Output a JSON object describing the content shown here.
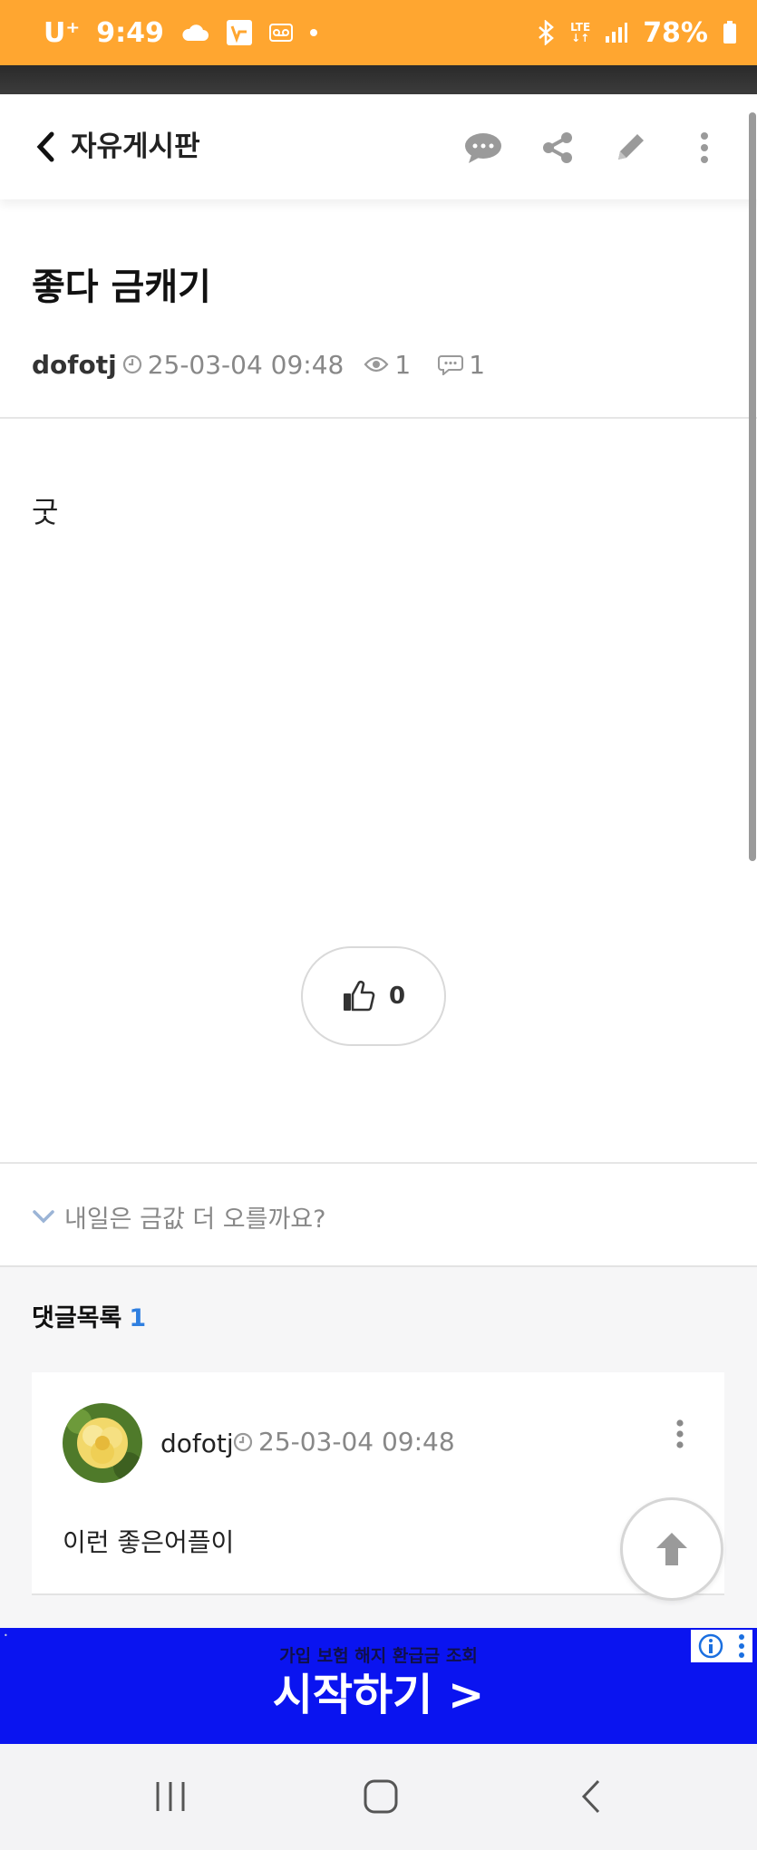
{
  "status_bar": {
    "carrier": "U⁺",
    "time": "9:49",
    "lte": "LTE",
    "battery": "78%",
    "icons": [
      "cloud-icon",
      "app-badge-icon",
      "voicemail-icon",
      "dot-icon",
      "bluetooth-icon",
      "lte-icon",
      "signal-icon",
      "battery-icon"
    ]
  },
  "header": {
    "title": "자유게시판",
    "icons": [
      "back-icon",
      "comment-bubble-icon",
      "share-icon",
      "edit-pencil-icon",
      "more-vertical-icon"
    ]
  },
  "post": {
    "title": "좋다 금캐기",
    "author": "dofotj",
    "date": "25-03-04 09:48",
    "views": "1",
    "comments": "1",
    "body": "굿",
    "likes": "0"
  },
  "next_post": {
    "title": "내일은 금값 더 오를까요?"
  },
  "comments": {
    "heading": "댓글목록",
    "count": "1",
    "items": [
      {
        "author": "dofotj",
        "date": "25-03-04 09:48",
        "text": "이런 좋은어플이"
      }
    ]
  },
  "ad": {
    "subtitle": "가입 보험 해지 환급금 조회",
    "headline": "시작하기 >"
  },
  "colors": {
    "status_bar": "#FFA630",
    "accent_blue": "#2f7fe0",
    "ad_background": "#0a14f0"
  }
}
